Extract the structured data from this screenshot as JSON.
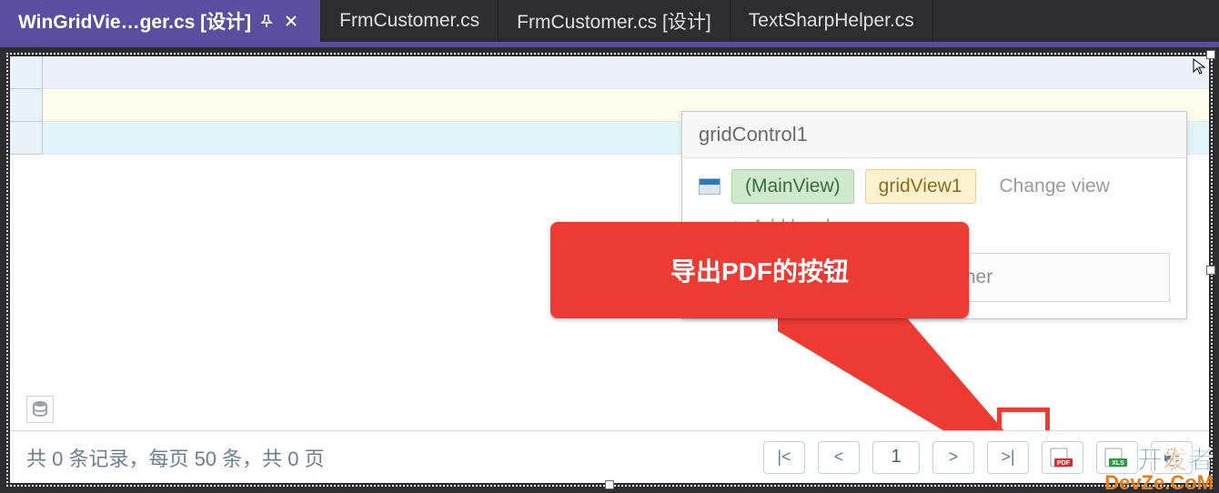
{
  "tabs": {
    "active": {
      "label": "WinGridVie…ger.cs [设计]"
    },
    "t1": {
      "label": "FrmCustomer.cs"
    },
    "t2": {
      "label": "FrmCustomer.cs [设计]"
    },
    "t3": {
      "label": "TextSharpHelper.cs"
    }
  },
  "smarttag": {
    "title": "gridControl1",
    "main_view": "(MainView)",
    "view_name": "gridView1",
    "change_view": "Change view",
    "add_level": "Add level",
    "run_designer": "Run Designer"
  },
  "callout": {
    "text": "导出PDF的按钮"
  },
  "pager": {
    "status": "共 0 条记录，每页 50 条，共 0 页",
    "first": "|<",
    "prev": "<",
    "page_value": "1",
    "next": ">",
    "last": ">|",
    "pdf_label": "PDF",
    "xls_label": "XLS"
  },
  "watermark": {
    "line1_a": "开",
    "line1_b": "发",
    "line1_c": "者",
    "line2": "DevZe.CoM"
  }
}
